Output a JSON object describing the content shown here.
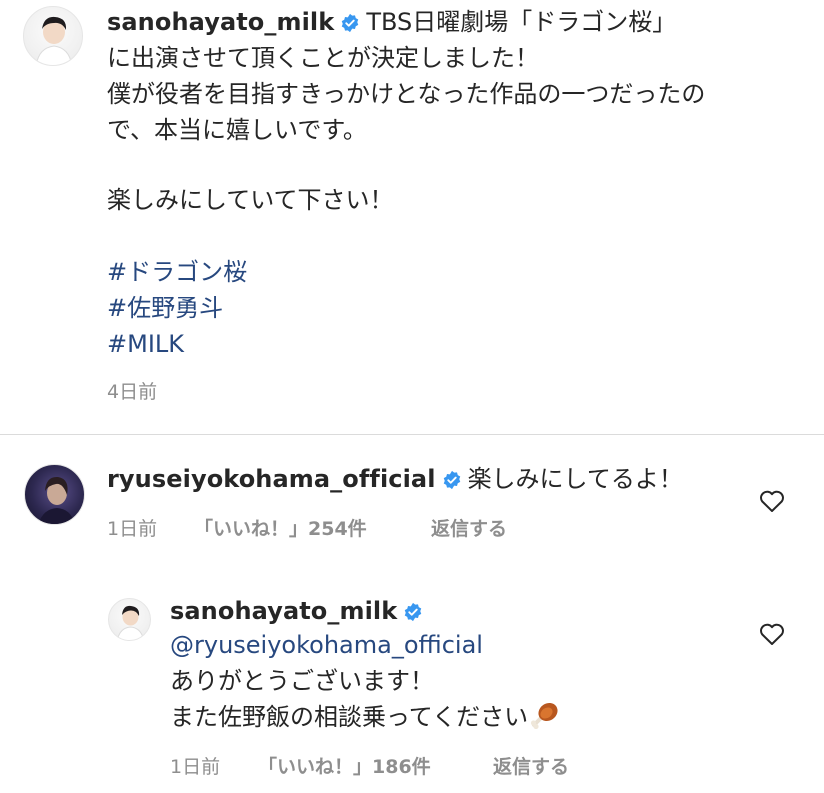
{
  "caption": {
    "username": "sanohayato_milk",
    "lines": [
      "TBS日曜劇場「ドラゴン桜」",
      "に出演させて頂くことが決定しました！",
      "僕が役者を目指すきっかけとなった作品の一つだったの",
      "で、本当に嬉しいです。",
      "楽しみにしていて下さい！"
    ],
    "hashtags": [
      "#ドラゴン桜",
      "#佐野勇斗",
      "#MILK"
    ],
    "time": "4日前"
  },
  "comment": {
    "username": "ryuseiyokohama_official",
    "text": "楽しみにしてるよ！",
    "time": "1日前",
    "likes": "「いいね！」254件",
    "reply_label": "返信する"
  },
  "reply": {
    "username": "sanohayato_milk",
    "mention": "@ryuseiyokohama_official",
    "line1": "ありがとうございます！",
    "line2": "また佐野飯の相談乗ってください",
    "emoji_name": "meat-on-bone-icon",
    "time": "1日前",
    "likes": "「いいね！」186件",
    "reply_label": "返信する"
  },
  "icons": {
    "verified_color": "#3897f0",
    "heart": "heart-outline-icon"
  },
  "colors": {
    "text": "#262626",
    "meta": "#8e8e8e",
    "link": "#27487f",
    "divider": "#dbdbdb"
  }
}
